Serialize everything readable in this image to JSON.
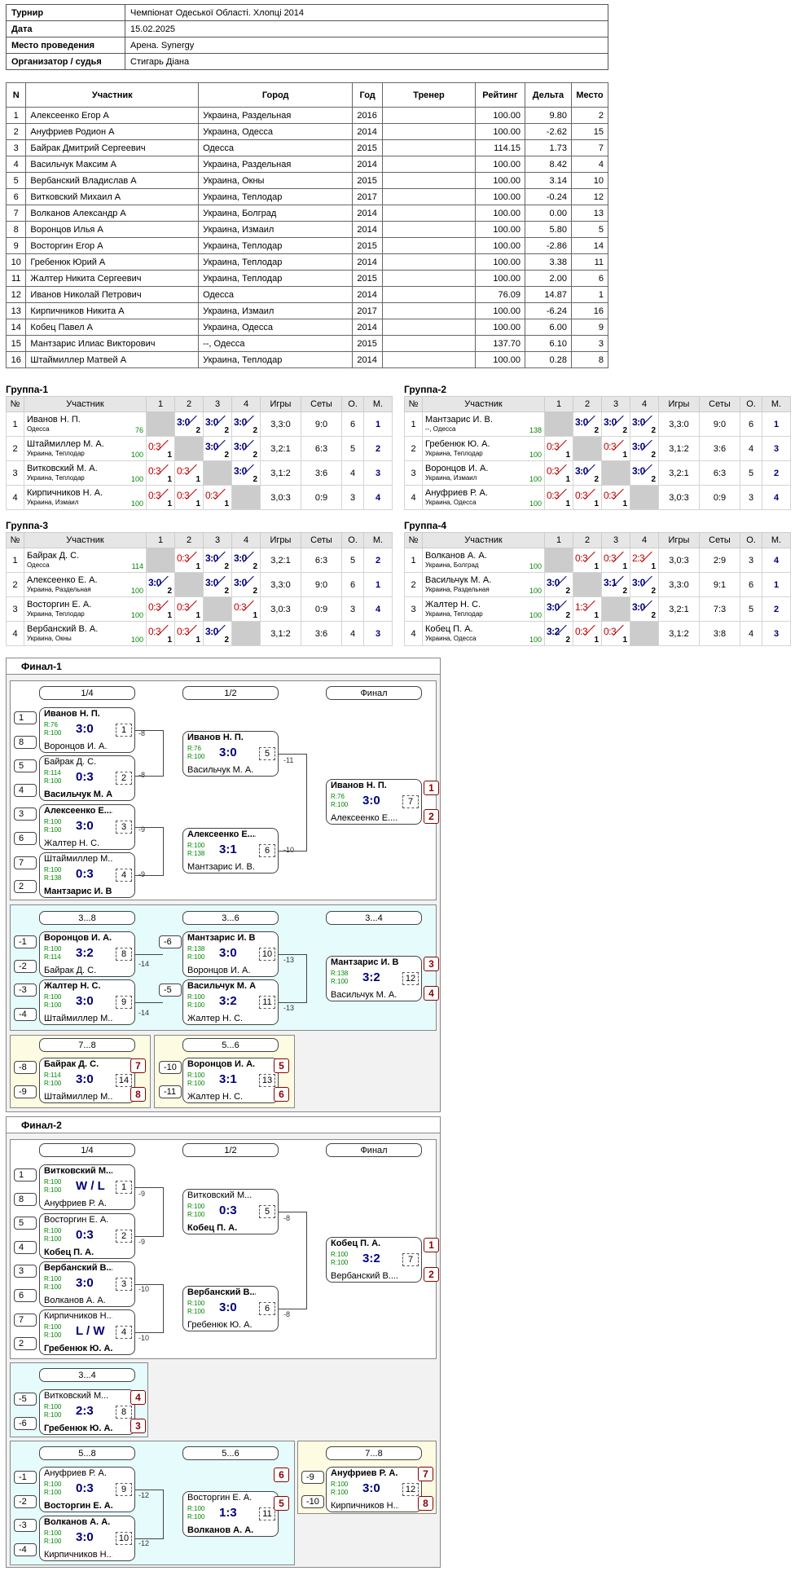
{
  "info": [
    {
      "k": "Турнир",
      "v": "Чемпіонат Одеської Області. Хлопці 2014"
    },
    {
      "k": "Дата",
      "v": "15.02.2025"
    },
    {
      "k": "Место проведения",
      "v": "Арена. Synergy"
    },
    {
      "k": "Организатор / судья",
      "v": "Стигарь Діана"
    }
  ],
  "players": {
    "headers": [
      "N",
      "Участник",
      "Город",
      "Год",
      "Тренер",
      "Рейтинг",
      "Дельта",
      "Место"
    ],
    "rows": [
      [
        "1",
        "Алексеенко Егор А",
        "Украина, Раздельная",
        "2016",
        "",
        "100.00",
        "9.80",
        "2"
      ],
      [
        "2",
        "Ануфриев Родион А",
        "Украина, Одесса",
        "2014",
        "",
        "100.00",
        "-2.62",
        "15"
      ],
      [
        "3",
        "Байрак Дмитрий Сергеевич",
        "Одесса",
        "2015",
        "",
        "114.15",
        "1.73",
        "7"
      ],
      [
        "4",
        "Васильчук Максим А",
        "Украина, Раздельная",
        "2014",
        "",
        "100.00",
        "8.42",
        "4"
      ],
      [
        "5",
        "Вербанский Владислав А",
        "Украина, Окны",
        "2015",
        "",
        "100.00",
        "3.14",
        "10"
      ],
      [
        "6",
        "Витковский Михаил А",
        "Украина, Теплодар",
        "2017",
        "",
        "100.00",
        "-0.24",
        "12"
      ],
      [
        "7",
        "Волканов Александр А",
        "Украина, Болград",
        "2014",
        "",
        "100.00",
        "0.00",
        "13"
      ],
      [
        "8",
        "Воронцов Илья А",
        "Украина, Измаил",
        "2014",
        "",
        "100.00",
        "5.80",
        "5"
      ],
      [
        "9",
        "Восторгин Егор А",
        "Украина, Теплодар",
        "2015",
        "",
        "100.00",
        "-2.86",
        "14"
      ],
      [
        "10",
        "Гребенюк Юрий А",
        "Украина, Теплодар",
        "2014",
        "",
        "100.00",
        "3.38",
        "11"
      ],
      [
        "11",
        "Жалтер Никита Сергеевич",
        "Украина, Теплодар",
        "2015",
        "",
        "100.00",
        "2.00",
        "6"
      ],
      [
        "12",
        "Иванов Николай Петрович",
        "Одесса",
        "2014",
        "",
        "76.09",
        "14.87",
        "1"
      ],
      [
        "13",
        "Кирпичников Никита А",
        "Украина, Измаил",
        "2017",
        "",
        "100.00",
        "-6.24",
        "16"
      ],
      [
        "14",
        "Кобец Павел А",
        "Украина, Одесса",
        "2014",
        "",
        "100.00",
        "6.00",
        "9"
      ],
      [
        "15",
        "Мантзарис Илиас Викторович",
        "--, Одесса",
        "2015",
        "",
        "137.70",
        "6.10",
        "3"
      ],
      [
        "16",
        "Штаймиллер Матвей А",
        "Украина, Теплодар",
        "2014",
        "",
        "100.00",
        "0.28",
        "8"
      ]
    ]
  },
  "group_headers": [
    "№",
    "Участник",
    "1",
    "2",
    "3",
    "4",
    "Игры",
    "Сеты",
    "О.",
    "М."
  ],
  "groups": [
    {
      "title": "Группа-1",
      "rows": [
        {
          "n": "1",
          "name": "Иванов Н. П.",
          "city": "Одесса",
          "rating": "76",
          "cells": [
            null,
            [
              "3:0",
              "2",
              "w"
            ],
            [
              "3:0",
              "2",
              "w"
            ],
            [
              "3:0",
              "2",
              "w"
            ]
          ],
          "games": "3,3:0",
          "sets": "9:0",
          "o": "6",
          "m": "1"
        },
        {
          "n": "2",
          "name": "Штаймиллер М. А.",
          "city": "Украина, Теплодар",
          "rating": "100",
          "cells": [
            [
              "0:3",
              "1",
              "l"
            ],
            null,
            [
              "3:0",
              "2",
              "w"
            ],
            [
              "3:0",
              "2",
              "w"
            ]
          ],
          "games": "3,2:1",
          "sets": "6:3",
          "o": "5",
          "m": "2"
        },
        {
          "n": "3",
          "name": "Витковский М. А.",
          "city": "Украина, Теплодар",
          "rating": "100",
          "cells": [
            [
              "0:3",
              "1",
              "l"
            ],
            [
              "0:3",
              "1",
              "l"
            ],
            null,
            [
              "3:0",
              "2",
              "w"
            ]
          ],
          "games": "3,1:2",
          "sets": "3:6",
          "o": "4",
          "m": "3"
        },
        {
          "n": "4",
          "name": "Кирпичников Н. А.",
          "city": "Украина, Измаил",
          "rating": "100",
          "cells": [
            [
              "0:3",
              "1",
              "l"
            ],
            [
              "0:3",
              "1",
              "l"
            ],
            [
              "0:3",
              "1",
              "l"
            ],
            null
          ],
          "games": "3,0:3",
          "sets": "0:9",
          "o": "3",
          "m": "4"
        }
      ]
    },
    {
      "title": "Группа-2",
      "rows": [
        {
          "n": "1",
          "name": "Мантзарис И. В.",
          "city": "--, Одесса",
          "rating": "138",
          "cells": [
            null,
            [
              "3:0",
              "2",
              "w"
            ],
            [
              "3:0",
              "2",
              "w"
            ],
            [
              "3:0",
              "2",
              "w"
            ]
          ],
          "games": "3,3:0",
          "sets": "9:0",
          "o": "6",
          "m": "1"
        },
        {
          "n": "2",
          "name": "Гребенюк Ю. А.",
          "city": "Украина, Теплодар",
          "rating": "100",
          "cells": [
            [
              "0:3",
              "1",
              "l"
            ],
            null,
            [
              "0:3",
              "1",
              "l"
            ],
            [
              "3:0",
              "2",
              "w"
            ]
          ],
          "games": "3,1:2",
          "sets": "3:6",
          "o": "4",
          "m": "3"
        },
        {
          "n": "3",
          "name": "Воронцов И. А.",
          "city": "Украина, Измаил",
          "rating": "100",
          "cells": [
            [
              "0:3",
              "1",
              "l"
            ],
            [
              "3:0",
              "2",
              "w"
            ],
            null,
            [
              "3:0",
              "2",
              "w"
            ]
          ],
          "games": "3,2:1",
          "sets": "6:3",
          "o": "5",
          "m": "2"
        },
        {
          "n": "4",
          "name": "Ануфриев Р. А.",
          "city": "Украина, Одесса",
          "rating": "100",
          "cells": [
            [
              "0:3",
              "1",
              "l"
            ],
            [
              "0:3",
              "1",
              "l"
            ],
            [
              "0:3",
              "1",
              "l"
            ],
            null
          ],
          "games": "3,0:3",
          "sets": "0:9",
          "o": "3",
          "m": "4"
        }
      ]
    },
    {
      "title": "Группа-3",
      "rows": [
        {
          "n": "1",
          "name": "Байрак Д. С.",
          "city": "Одесса",
          "rating": "114",
          "cells": [
            null,
            [
              "0:3",
              "1",
              "l"
            ],
            [
              "3:0",
              "2",
              "w"
            ],
            [
              "3:0",
              "2",
              "w"
            ]
          ],
          "games": "3,2:1",
          "sets": "6:3",
          "o": "5",
          "m": "2"
        },
        {
          "n": "2",
          "name": "Алексеенко Е. А.",
          "city": "Украина, Раздельная",
          "rating": "100",
          "cells": [
            [
              "3:0",
              "2",
              "w"
            ],
            null,
            [
              "3:0",
              "2",
              "w"
            ],
            [
              "3:0",
              "2",
              "w"
            ]
          ],
          "games": "3,3:0",
          "sets": "9:0",
          "o": "6",
          "m": "1"
        },
        {
          "n": "3",
          "name": "Восторгин Е. А.",
          "city": "Украина, Теплодар",
          "rating": "100",
          "cells": [
            [
              "0:3",
              "1",
              "l"
            ],
            [
              "0:3",
              "1",
              "l"
            ],
            null,
            [
              "0:3",
              "1",
              "l"
            ]
          ],
          "games": "3,0:3",
          "sets": "0:9",
          "o": "3",
          "m": "4"
        },
        {
          "n": "4",
          "name": "Вербанский В. А.",
          "city": "Украина, Окны",
          "rating": "100",
          "cells": [
            [
              "0:3",
              "1",
              "l"
            ],
            [
              "0:3",
              "1",
              "l"
            ],
            [
              "3:0",
              "2",
              "w"
            ],
            null
          ],
          "games": "3,1:2",
          "sets": "3:6",
          "o": "4",
          "m": "3"
        }
      ]
    },
    {
      "title": "Группа-4",
      "rows": [
        {
          "n": "1",
          "name": "Волканов А. А.",
          "city": "Украина, Болград",
          "rating": "100",
          "cells": [
            null,
            [
              "0:3",
              "1",
              "l"
            ],
            [
              "0:3",
              "1",
              "l"
            ],
            [
              "2:3",
              "1",
              "l"
            ]
          ],
          "games": "3,0:3",
          "sets": "2:9",
          "o": "3",
          "m": "4"
        },
        {
          "n": "2",
          "name": "Васильчук М. А.",
          "city": "Украина, Раздельная",
          "rating": "100",
          "cells": [
            [
              "3:0",
              "2",
              "w"
            ],
            null,
            [
              "3:1",
              "2",
              "w"
            ],
            [
              "3:0",
              "2",
              "w"
            ]
          ],
          "games": "3,3:0",
          "sets": "9:1",
          "o": "6",
          "m": "1"
        },
        {
          "n": "3",
          "name": "Жалтер Н. С.",
          "city": "Украина, Теплодар",
          "rating": "100",
          "cells": [
            [
              "3:0",
              "2",
              "w"
            ],
            [
              "1:3",
              "1",
              "l"
            ],
            null,
            [
              "3:0",
              "2",
              "w"
            ]
          ],
          "games": "3,2:1",
          "sets": "7:3",
          "o": "5",
          "m": "2"
        },
        {
          "n": "4",
          "name": "Кобец П. А.",
          "city": "Украина, Одесса",
          "rating": "100",
          "cells": [
            [
              "3:2",
              "2",
              "w"
            ],
            [
              "0:3",
              "1",
              "l"
            ],
            [
              "0:3",
              "1",
              "l"
            ],
            null
          ],
          "games": "3,1:2",
          "sets": "3:8",
          "o": "4",
          "m": "3"
        }
      ]
    }
  ],
  "finals": [
    {
      "title": "Финал-1"
    },
    {
      "title": "Финал-2"
    }
  ],
  "bracket_labels": [
    "1/4",
    "1/2",
    "Финал",
    "3...8",
    "3...6",
    "3...4",
    "7...8",
    "5...6",
    "1/4",
    "1/2",
    "Финал",
    "3...4",
    "5...8",
    "5...6",
    "7...8"
  ],
  "seeds": [
    "1",
    "8",
    "5",
    "4",
    "3",
    "6",
    "7",
    "2",
    "-1",
    "-2",
    "-3",
    "-4",
    "-6",
    "-5",
    "-8",
    "-9",
    "-10",
    "-11",
    "1",
    "8",
    "5",
    "4",
    "3",
    "6",
    "7",
    "2",
    "-5",
    "-6",
    "-1",
    "-2",
    "-3",
    "-4",
    "-9",
    "-10"
  ],
  "links": [
    "-8",
    "-8",
    "-9",
    "-9",
    "-11",
    "-10",
    "-14",
    "-14",
    "-13",
    "-13",
    "-9",
    "-9",
    "-10",
    "-10",
    "-8",
    "-8",
    "-12",
    "-12"
  ],
  "ranks": [
    "1",
    "2",
    "3",
    "4",
    "7",
    "8",
    "5",
    "6",
    "1",
    "2",
    "4",
    "3",
    "6",
    "5",
    "7",
    "8"
  ],
  "matches": [
    {
      "a": "Иванов Н. П.",
      "r1": "R:76",
      "r2": "R:100",
      "s": "3:0",
      "b": "Воронцов И. А.",
      "n": "1"
    },
    {
      "a": "Байрак Д. С.",
      "r1": "R:114",
      "r2": "R:100",
      "s": "0:3",
      "b": "Васильчук М. А.",
      "n": "2",
      "bw": true
    },
    {
      "a": "Алексеенко Е....",
      "r1": "R:100",
      "r2": "R:100",
      "s": "3:0",
      "b": "Жалтер Н. С.",
      "n": "3"
    },
    {
      "a": "Штаймиллер М...",
      "r1": "R:100",
      "r2": "R:138",
      "s": "0:3",
      "b": "Мантзарис И. В.",
      "n": "4",
      "bw": true
    },
    {
      "a": "Иванов Н. П.",
      "r1": "R:76",
      "r2": "R:100",
      "s": "3:0",
      "b": "Васильчук М. А.",
      "n": "5"
    },
    {
      "a": "Алексеенко Е....",
      "r1": "R:100",
      "r2": "R:138",
      "s": "3:1",
      "b": "Мантзарис И. В.",
      "n": "6"
    },
    {
      "a": "Иванов Н. П.",
      "r1": "R:76",
      "r2": "R:100",
      "s": "3:0",
      "b": "Алексеенко Е....",
      "n": "7"
    },
    {
      "a": "Воронцов И. А.",
      "r1": "R:100",
      "r2": "R:114",
      "s": "3:2",
      "b": "Байрак Д. С.",
      "n": "8"
    },
    {
      "a": "Жалтер Н. С.",
      "r1": "R:100",
      "r2": "R:100",
      "s": "3:0",
      "b": "Штаймиллер М...",
      "n": "9"
    },
    {
      "a": "Мантзарис И. В.",
      "r1": "R:138",
      "r2": "R:100",
      "s": "3:0",
      "b": "Воронцов И. А.",
      "n": "10"
    },
    {
      "a": "Васильчук М. А.",
      "r1": "R:100",
      "r2": "R:100",
      "s": "3:2",
      "b": "Жалтер Н. С.",
      "n": "11"
    },
    {
      "a": "Мантзарис И. В.",
      "r1": "R:138",
      "r2": "R:100",
      "s": "3:2",
      "b": "Васильчук М. А.",
      "n": "12"
    },
    {
      "a": "Байрак Д. С.",
      "r1": "R:114",
      "r2": "R:100",
      "s": "3:0",
      "b": "Штаймиллер М...",
      "n": "14"
    },
    {
      "a": "Воронцов И. А.",
      "r1": "R:100",
      "r2": "R:100",
      "s": "3:1",
      "b": "Жалтер Н. С.",
      "n": "13"
    },
    {
      "a": "Витковский М...",
      "r1": "R:100",
      "r2": "R:100",
      "s": "W / L",
      "b": "Ануфриев Р. А.",
      "n": "1"
    },
    {
      "a": "Восторгин Е. А.",
      "r1": "R:100",
      "r2": "R:100",
      "s": "0:3",
      "b": "Кобец П. А.",
      "n": "2",
      "bw": true
    },
    {
      "a": "Вербанский В....",
      "r1": "R:100",
      "r2": "R:100",
      "s": "3:0",
      "b": "Волканов А. А.",
      "n": "3"
    },
    {
      "a": "Кирпичников Н...",
      "r1": "R:100",
      "r2": "R:100",
      "s": "L / W",
      "b": "Гребенюк Ю. А.",
      "n": "4",
      "bw": true
    },
    {
      "a": "Витковский М...",
      "r1": "R:100",
      "r2": "R:100",
      "s": "0:3",
      "b": "Кобец П. А.",
      "n": "5",
      "bw": true
    },
    {
      "a": "Вербанский В....",
      "r1": "R:100",
      "r2": "R:100",
      "s": "3:0",
      "b": "Гребенюк Ю. А.",
      "n": "6"
    },
    {
      "a": "Кобец П. А.",
      "r1": "R:100",
      "r2": "R:100",
      "s": "3:2",
      "b": "Вербанский В....",
      "n": "7"
    },
    {
      "a": "Витковский М...",
      "r1": "R:100",
      "r2": "R:100",
      "s": "2:3",
      "b": "Гребенюк Ю. А.",
      "n": "8",
      "bw": true
    },
    {
      "a": "Ануфриев Р. А.",
      "r1": "R:100",
      "r2": "R:100",
      "s": "0:3",
      "b": "Восторгин Е. А.",
      "n": "9",
      "bw": true
    },
    {
      "a": "Волканов А. А.",
      "r1": "R:100",
      "r2": "R:100",
      "s": "3:0",
      "b": "Кирпичников Н...",
      "n": "10"
    },
    {
      "a": "Восторгин Е. А.",
      "r1": "R:100",
      "r2": "R:100",
      "s": "1:3",
      "b": "Волканов А. А.",
      "n": "11",
      "bw": true
    },
    {
      "a": "Ануфриев Р. А.",
      "r1": "R:100",
      "r2": "R:100",
      "s": "3:0",
      "b": "Кирпичников Н...",
      "n": "12"
    }
  ],
  "colors": {
    "winner_score": "#00007a",
    "loser_score": "#c00000",
    "rating": "#008000",
    "rank": "#8a0000",
    "light_cyan": "#e6fbfb",
    "light_yellow": "#fdfbe1"
  }
}
